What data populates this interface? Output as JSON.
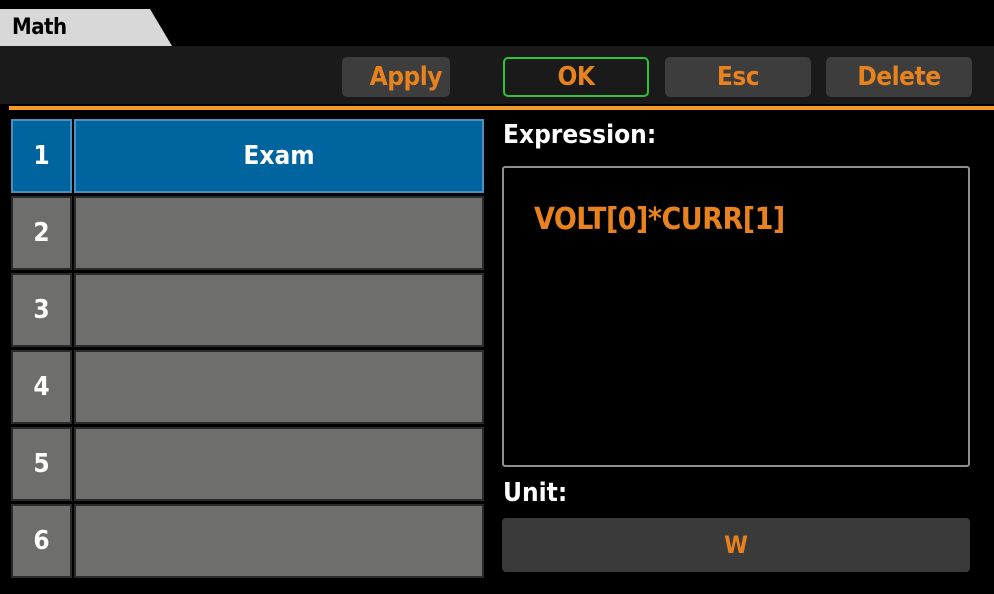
{
  "tab": {
    "label": "Math"
  },
  "toolbar": {
    "apply_label": "Apply",
    "ok_label": "OK",
    "esc_label": "Esc",
    "delete_label": "Delete"
  },
  "table": {
    "rows": [
      {
        "number": "1",
        "name": "Exam",
        "selected": true
      },
      {
        "number": "2",
        "name": ""
      },
      {
        "number": "3",
        "name": ""
      },
      {
        "number": "4",
        "name": ""
      },
      {
        "number": "5",
        "name": ""
      },
      {
        "number": "6",
        "name": ""
      }
    ]
  },
  "expression": {
    "label": "Expression:",
    "value": "VOLT[0]*CURR[1]"
  },
  "unit": {
    "label": "Unit:",
    "value": "W"
  },
  "colors": {
    "accent": "#e8821e",
    "selected_row": "#00659f",
    "row_bg": "#6e6f6c",
    "ok_border": "#31c33a"
  }
}
